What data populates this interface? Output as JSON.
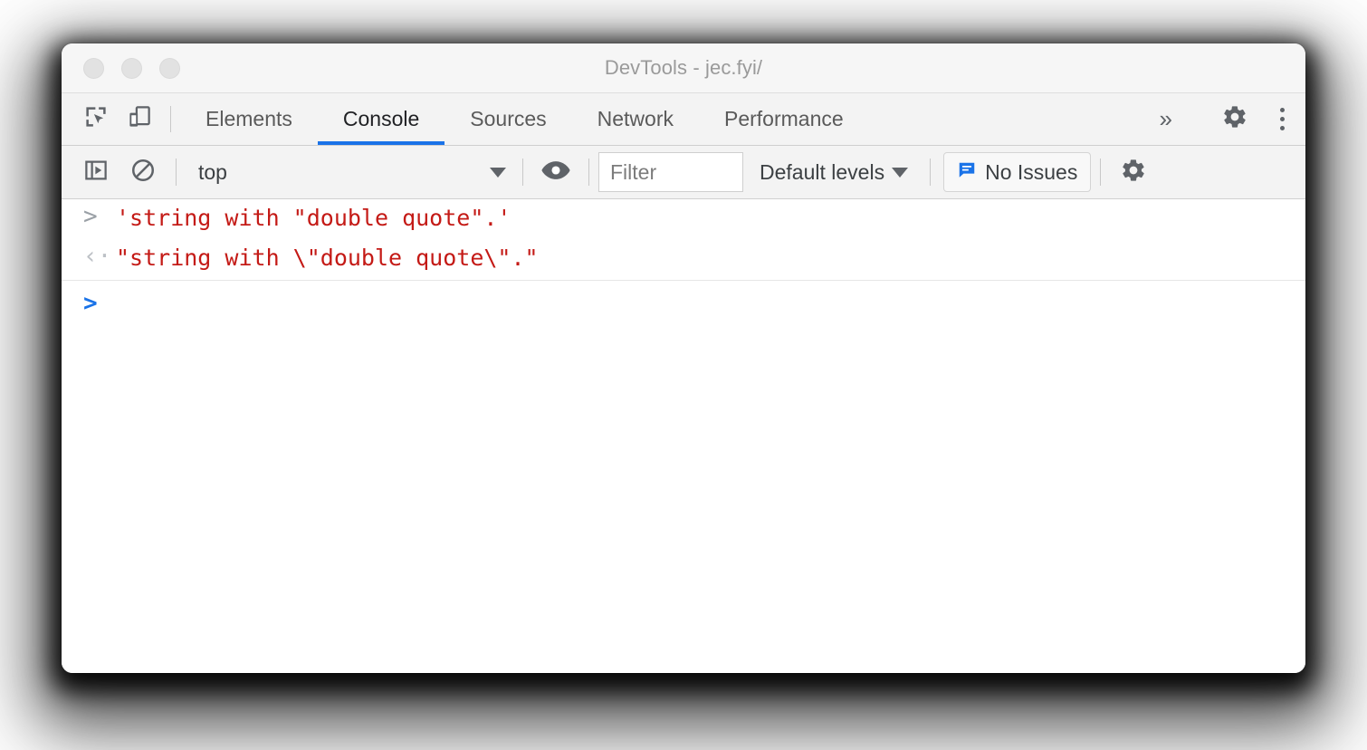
{
  "window": {
    "title": "DevTools - jec.fyi/",
    "traffic_lights": [
      "close",
      "minimize",
      "maximize"
    ]
  },
  "tabbar": {
    "inspect_icon": "inspect-element-icon",
    "device_icon": "device-toolbar-icon",
    "tabs": [
      {
        "label": "Elements",
        "active": false
      },
      {
        "label": "Console",
        "active": true
      },
      {
        "label": "Sources",
        "active": false
      },
      {
        "label": "Network",
        "active": false
      },
      {
        "label": "Performance",
        "active": false
      }
    ],
    "overflow_label": "»",
    "settings_icon": "gear-icon",
    "more_icon": "more-vertical-icon",
    "active_underline_color": "#1a73e8"
  },
  "console_toolbar": {
    "sidebar_toggle_icon": "console-sidebar-icon",
    "clear_icon": "clear-console-icon",
    "context": {
      "value": "top",
      "caret_icon": "chevron-down-icon"
    },
    "eye_icon": "live-expression-eye-icon",
    "filter": {
      "value": "",
      "placeholder": "Filter"
    },
    "levels": {
      "label": "Default levels",
      "caret_icon": "chevron-down-icon"
    },
    "issues": {
      "label": "No Issues",
      "icon": "issues-message-icon",
      "icon_color": "#1a73e8"
    },
    "settings_icon": "gear-icon"
  },
  "console": {
    "text_color": "#c41a16",
    "messages": [
      {
        "kind": "input",
        "gutter_icon": "input-chevron-icon",
        "text": "'string with \"double quote\".'"
      },
      {
        "kind": "result",
        "gutter_icon": "result-chevron-icon",
        "text": "\"string with \\\"double quote\\\".\""
      }
    ],
    "prompt": {
      "caret": ">",
      "value": ""
    }
  }
}
